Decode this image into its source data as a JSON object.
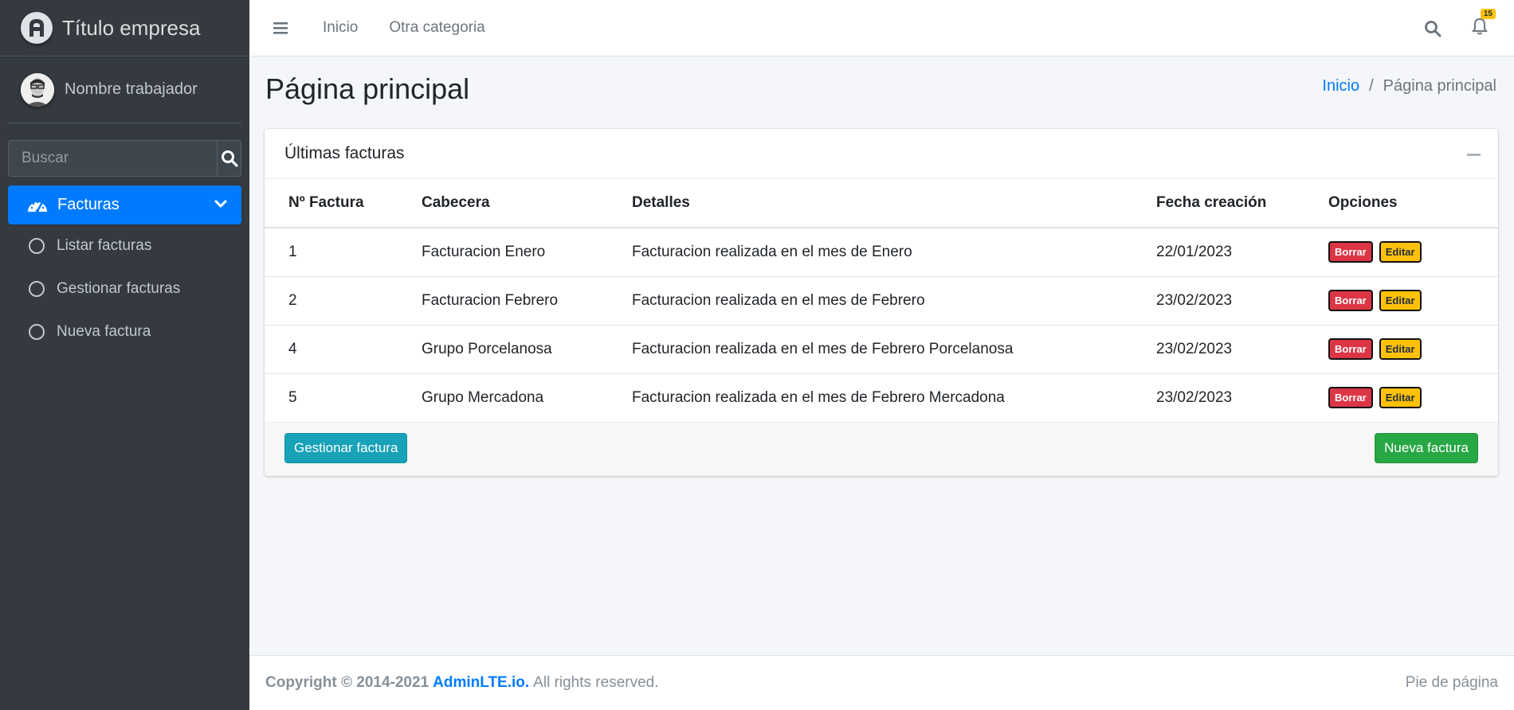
{
  "brand": {
    "title": "Título empresa",
    "logo_icon": "adminlte-logo-icon"
  },
  "user": {
    "name": "Nombre trabajador"
  },
  "search": {
    "placeholder": "Buscar"
  },
  "sidebar": {
    "active": {
      "label": "Facturas",
      "icon": "tachometer-icon"
    },
    "items": [
      {
        "label": "Listar facturas"
      },
      {
        "label": "Gestionar facturas"
      },
      {
        "label": "Nueva factura"
      }
    ]
  },
  "topbar": {
    "links": [
      "Inicio",
      "Otra categoria"
    ],
    "notification_count": "15"
  },
  "page": {
    "title": "Página principal",
    "breadcrumb": {
      "home": "Inicio",
      "separator": "/",
      "current": "Página principal"
    }
  },
  "card": {
    "title": "Últimas facturas",
    "columns": [
      "Nº Factura",
      "Cabecera",
      "Detalles",
      "Fecha creación",
      "Opciones"
    ],
    "rows": [
      {
        "num": "1",
        "cabecera": "Facturacion Enero",
        "detalles": "Facturacion realizada en el mes de Enero",
        "fecha": "22/01/2023"
      },
      {
        "num": "2",
        "cabecera": "Facturacion Febrero",
        "detalles": "Facturacion realizada en el mes de Febrero",
        "fecha": "23/02/2023"
      },
      {
        "num": "4",
        "cabecera": "Grupo Porcelanosa",
        "detalles": "Facturacion realizada en el mes de Febrero Porcelanosa",
        "fecha": "23/02/2023"
      },
      {
        "num": "5",
        "cabecera": "Grupo Mercadona",
        "detalles": "Facturacion realizada en el mes de Febrero Mercadona",
        "fecha": "23/02/2023"
      }
    ],
    "delete_label": "Borrar",
    "edit_label": "Editar",
    "footer_left_button": "Gestionar factura",
    "footer_right_button": "Nueva factura"
  },
  "footer": {
    "copyright": "Copyright © 2014-2021",
    "brand_link": "AdminLTE.io.",
    "rights": "All rights reserved.",
    "right_text": "Pie de página"
  },
  "colors": {
    "sidebar_bg": "#343a40",
    "primary": "#007bff",
    "danger": "#dc3545",
    "warning": "#ffc107",
    "info": "#17a2b8",
    "success": "#28a745"
  }
}
